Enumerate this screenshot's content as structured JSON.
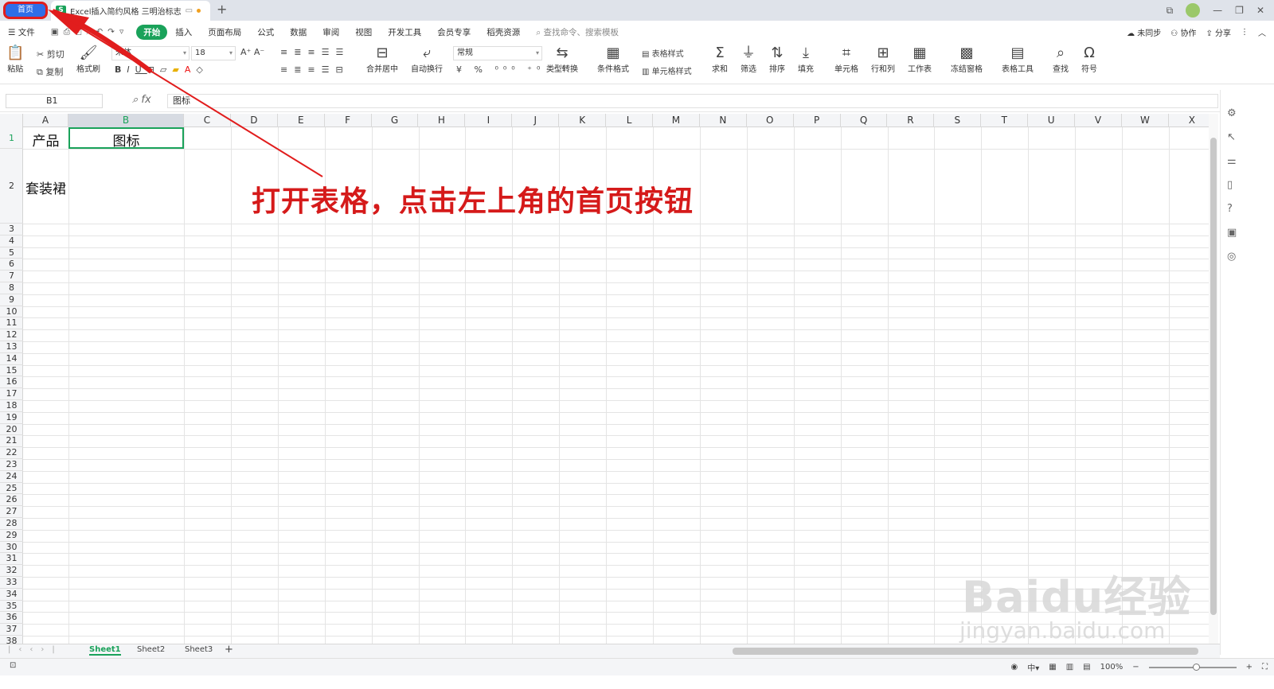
{
  "titlebar": {
    "home_tab": "首页",
    "doc_title": "Excel插入简约风格 三明治标志",
    "new_tab": "+"
  },
  "menu": {
    "file": "文件",
    "tabs": [
      "开始",
      "插入",
      "页面布局",
      "公式",
      "数据",
      "审阅",
      "视图",
      "开发工具",
      "会员专享",
      "稻壳资源"
    ],
    "search_placeholder": "查找命令、搜索模板",
    "right": [
      "未同步",
      "协作",
      "分享"
    ]
  },
  "ribbon": {
    "paste": "粘贴",
    "cut": "剪切",
    "copy": "复制",
    "format_painter": "格式刷",
    "font_name": "宋体",
    "font_size": "18",
    "merge_center": "合并居中",
    "wrap": "自动换行",
    "number_format": "常规",
    "type_convert": "类型转换",
    "cond_format": "条件格式",
    "table_style": "表格样式",
    "cell_style": "单元格样式",
    "sum": "求和",
    "filter": "筛选",
    "sort": "排序",
    "fill": "填充",
    "cell": "单元格",
    "row_col": "行和列",
    "worksheet": "工作表",
    "freeze": "冻结窗格",
    "table_tools": "表格工具",
    "find": "查找",
    "symbol": "符号"
  },
  "formula_bar": {
    "name_box": "B1",
    "fx": "fx",
    "formula": "图标"
  },
  "columns": [
    "A",
    "B",
    "C",
    "D",
    "E",
    "F",
    "G",
    "H",
    "I",
    "J",
    "K",
    "L",
    "M",
    "N",
    "O",
    "P",
    "Q",
    "R",
    "S",
    "T",
    "U",
    "V",
    "W",
    "X"
  ],
  "rows": [
    "1",
    "2",
    "3",
    "4",
    "5",
    "6",
    "7",
    "8",
    "9",
    "10",
    "11",
    "12",
    "13",
    "14",
    "15",
    "16",
    "17",
    "18",
    "19",
    "20",
    "21",
    "22",
    "23",
    "24",
    "25",
    "26",
    "27",
    "28",
    "29",
    "30",
    "31",
    "32",
    "33",
    "34",
    "35",
    "36",
    "37",
    "38"
  ],
  "cells": {
    "a1": "产品",
    "b1": "图标",
    "a2": "套装裙"
  },
  "annotation": "打开表格，点击左上角的首页按钮",
  "sheets": [
    "Sheet1",
    "Sheet2",
    "Sheet3"
  ],
  "status": {
    "zoom": "100%"
  },
  "watermark": {
    "main": "Baidu经验",
    "sub": "jingyan.baidu.com"
  },
  "colors": {
    "accent": "#1aa25a",
    "home_tab": "#2f6ee8",
    "annotation": "#d51a1a"
  }
}
